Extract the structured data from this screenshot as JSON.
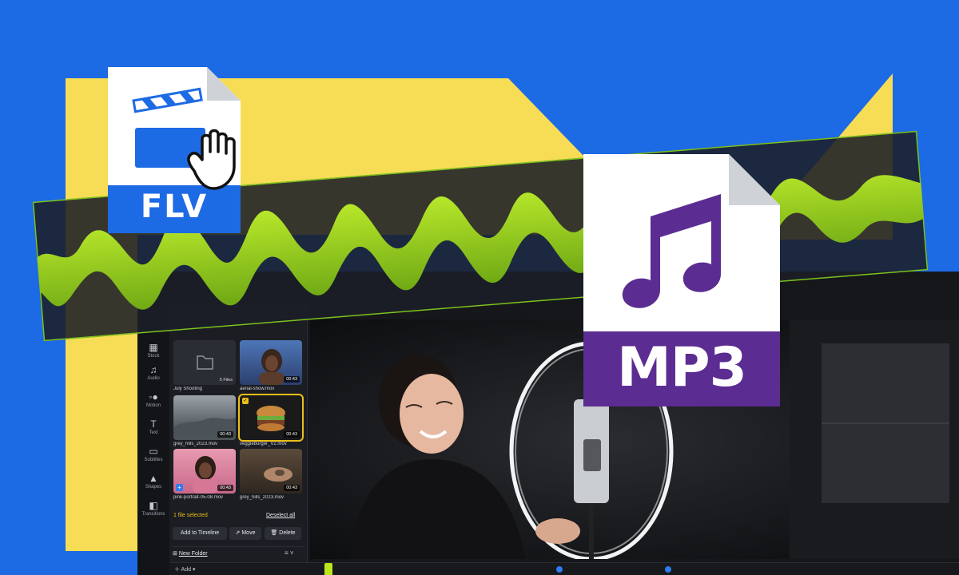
{
  "files": {
    "source": {
      "label": "FLV"
    },
    "target": {
      "label": "MP3"
    }
  },
  "editor": {
    "rail": [
      {
        "label": "Stock",
        "icon": "stock-icon"
      },
      {
        "label": "Audio",
        "icon": "music-note-icon"
      },
      {
        "label": "Motion",
        "icon": "motion-icon"
      },
      {
        "label": "Text",
        "icon": "text-icon"
      },
      {
        "label": "Subtitles",
        "icon": "subtitles-icon"
      },
      {
        "label": "Shapes",
        "icon": "shapes-icon"
      },
      {
        "label": "Transitions",
        "icon": "transitions-icon"
      }
    ],
    "media": {
      "items": [
        {
          "name": "July Shooting",
          "badge": "5 Files"
        },
        {
          "name": "aerial-show.mov",
          "duration": "00:43"
        },
        {
          "name": "grey_hills_2023.mov",
          "duration": "00:43"
        },
        {
          "name": "veggieburger_V2.mov",
          "duration": "00:43"
        },
        {
          "name": "pink-portrait-05-08.mov",
          "duration": "00:43"
        },
        {
          "name": "grey_hills_2023.mov",
          "duration": "00:43"
        }
      ],
      "selection_text": "1 file selected",
      "deselect_label": "Deselect all",
      "add_to_timeline_label": "Add to Timeline",
      "move_label": "Move",
      "delete_label": "Delete",
      "new_folder_label": "New Folder"
    }
  },
  "colors": {
    "background": "#1d6ae5",
    "yellow": "#f7dd55",
    "wave_green": "#8fd11e",
    "mp3_purple": "#5b2c91",
    "flv_blue": "#1d6ae5",
    "selection_yellow": "#e9bf1a"
  }
}
